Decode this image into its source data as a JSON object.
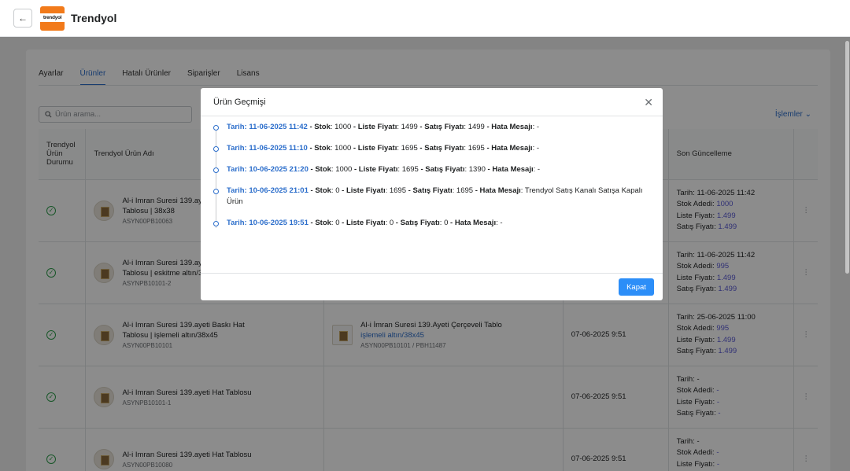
{
  "app": {
    "title": "Trendyol",
    "logo_text": "trendyol"
  },
  "tabs": [
    "Ayarlar",
    "Ürünler",
    "Hatalı Ürünler",
    "Siparişler",
    "Lisans"
  ],
  "search": {
    "placeholder": "Ürün arama..."
  },
  "actions_label": "İşlemler",
  "table": {
    "headers": {
      "status": "Trendyol Ürün Durumu",
      "name": "Trendyol Ürün Adı",
      "last_update": "Son Güncelleme"
    },
    "rows": [
      {
        "name_l1": "Al-i Imran Suresi 139.ayeti",
        "name_l2": "Tablosu | 38x38",
        "sku": "ASYN00PB10063",
        "tp_name": "",
        "tp_link": "",
        "tp_sku": "",
        "date": "",
        "tarih": "11-06-2025 11:42",
        "stok": "1000",
        "liste": "1.499",
        "satis": "1.499"
      },
      {
        "name_l1": "Al-i Imran Suresi 139.ayeti",
        "name_l2": "Tablosu | eskitme altın/3",
        "sku": "ASYNPB10101-2",
        "tp_name": "",
        "tp_link": "",
        "tp_sku": "",
        "date": "",
        "tarih": "11-06-2025 11:42",
        "stok": "995",
        "liste": "1.499",
        "satis": "1.499"
      },
      {
        "name_l1": "Al-i Imran Suresi 139.ayeti Baskı Hat",
        "name_l2": "Tablosu | işlemeli altın/38x45",
        "sku": "ASYN00PB10101",
        "tp_name": "Al-i İmran Suresi 139.Ayeti Çerçeveli Tablo",
        "tp_link": "işlemeli altın/38x45",
        "tp_sku": "ASYN00PB10101 / PBH11487",
        "date": "07-06-2025 9:51",
        "tarih": "25-06-2025 11:00",
        "stok": "995",
        "liste": "1.499",
        "satis": "1.499"
      },
      {
        "name_l1": "Al-i Imran Suresi 139.ayeti Hat Tablosu",
        "name_l2": "",
        "sku": "ASYNPB10101-1",
        "tp_name": "",
        "tp_link": "",
        "tp_sku": "",
        "date": "07-06-2025 9:51",
        "tarih": "-",
        "stok": "-",
        "liste": "-",
        "satis": "-"
      },
      {
        "name_l1": "Al-i Imran Suresi 139.ayeti Hat Tablosu",
        "name_l2": "",
        "sku": "ASYN00PB10080",
        "tp_name": "",
        "tp_link": "",
        "tp_sku": "",
        "date": "07-06-2025 9:51",
        "tarih": "-",
        "stok": "-",
        "liste": "-",
        "satis": "-"
      }
    ],
    "labels": {
      "tarih": "Tarih:",
      "stok": "Stok Adedi:",
      "liste": "Liste Fiyatı:",
      "satis": "Satış Fiyatı:"
    }
  },
  "modal": {
    "title": "Ürün Geçmişi",
    "close_button": "Kapat",
    "labels": {
      "tarih": "Tarih:",
      "stok": "Stok",
      "liste": "Liste Fiyatı",
      "satis": "Satış Fiyatı",
      "hata": "Hata Mesajı"
    },
    "entries": [
      {
        "date": "11-06-2025 11:42",
        "stok": "1000",
        "liste": "1499",
        "satis": "1499",
        "hata": "-"
      },
      {
        "date": "11-06-2025 11:10",
        "stok": "1000",
        "liste": "1695",
        "satis": "1695",
        "hata": "-"
      },
      {
        "date": "10-06-2025 21:20",
        "stok": "1000",
        "liste": "1695",
        "satis": "1390",
        "hata": "-"
      },
      {
        "date": "10-06-2025 21:01",
        "stok": "0",
        "liste": "1695",
        "satis": "1695",
        "hata": "Trendyol Satış Kanalı Satışa Kapalı Ürün"
      },
      {
        "date": "10-06-2025 19:51",
        "stok": "0",
        "liste": "0",
        "satis": "0",
        "hata": "-"
      }
    ]
  }
}
